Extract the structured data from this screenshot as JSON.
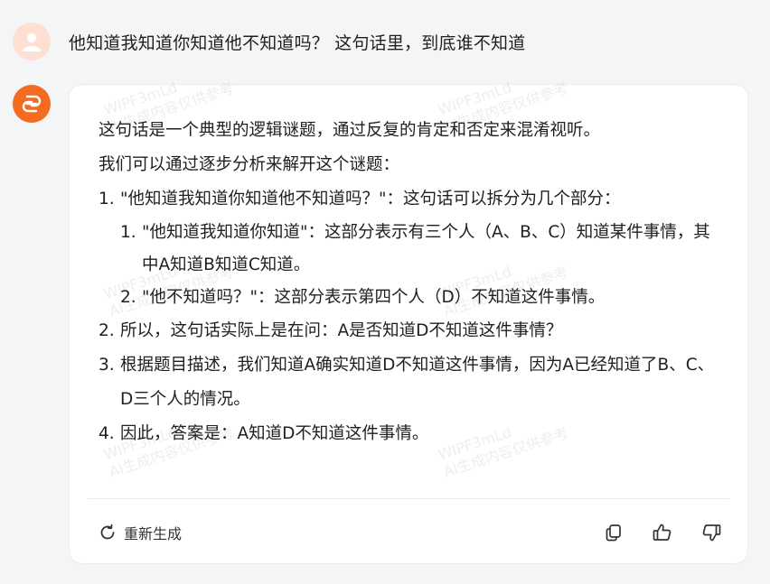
{
  "user": {
    "question": "他知道我知道你知道他不知道吗？ 这句话里，到底谁不知道"
  },
  "answer": {
    "intro_line1": "这句话是一个典型的逻辑谜题，通过反复的肯定和否定来混淆视听。",
    "intro_line2": "我们可以通过逐步分析来解开这个谜题：",
    "items": [
      {
        "num": "1.",
        "text": "\"他知道我知道你知道他不知道吗？\"：这句话可以拆分为几个部分：",
        "sub": [
          {
            "num": "1.",
            "text": "\"他知道我知道你知道\"：这部分表示有三个人（A、B、C）知道某件事情，其中A知道B知道C知道。"
          },
          {
            "num": "2.",
            "text": "\"他不知道吗？\"：这部分表示第四个人（D）不知道这件事情。"
          }
        ]
      },
      {
        "num": "2.",
        "text": "所以，这句话实际上是在问：A是否知道D不知道这件事情？"
      },
      {
        "num": "3.",
        "text": "根据题目描述，我们知道A确实知道D不知道这件事情，因为A已经知道了B、C、D三个人的情况。"
      },
      {
        "num": "4.",
        "text": "因此，答案是：A知道D不知道这件事情。"
      }
    ]
  },
  "footer": {
    "regenerate_label": "重新生成"
  },
  "watermark": {
    "line1": "WIPF3mLd",
    "line2": "AI生成内容仅供参考"
  },
  "colors": {
    "bot_avatar": "#f26b21",
    "user_avatar": "#fde0d2"
  },
  "icons": [
    "user-icon",
    "bot-logo-icon",
    "refresh-icon",
    "copy-icon",
    "thumbs-up-icon",
    "thumbs-down-icon"
  ]
}
